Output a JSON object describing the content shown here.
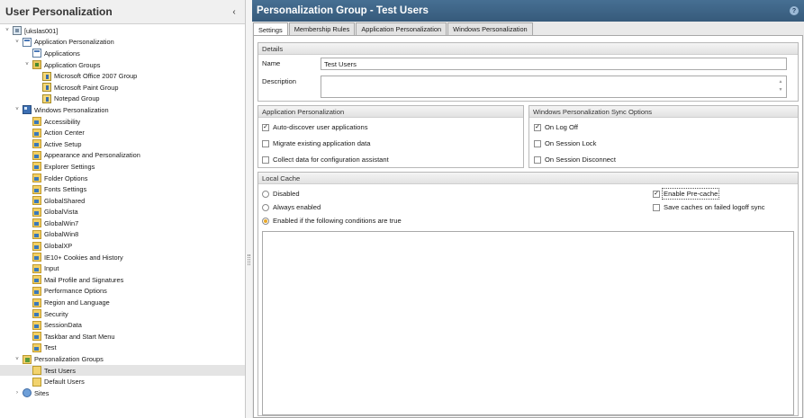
{
  "left_panel": {
    "title": "User Personalization",
    "collapse_glyph": "‹",
    "tree": [
      {
        "label": "[ukslas001]",
        "level": 0,
        "icon": "server-icon",
        "expander": "˅"
      },
      {
        "label": "Application Personalization",
        "level": 1,
        "icon": "app-icon",
        "expander": "˅"
      },
      {
        "label": "Applications",
        "level": 2,
        "icon": "app-icon",
        "expander": ""
      },
      {
        "label": "Application Groups",
        "level": 2,
        "icon": "group-icon",
        "expander": "˅"
      },
      {
        "label": "Microsoft Office 2007 Group",
        "level": 3,
        "icon": "group-item-icon",
        "expander": ""
      },
      {
        "label": "Microsoft Paint Group",
        "level": 3,
        "icon": "group-item-icon",
        "expander": ""
      },
      {
        "label": "Notepad Group",
        "level": 3,
        "icon": "group-item-icon",
        "expander": ""
      },
      {
        "label": "Windows Personalization",
        "level": 1,
        "icon": "windows-icon",
        "expander": "˅"
      },
      {
        "label": "Accessibility",
        "level": 2,
        "icon": "folder-icon",
        "expander": ""
      },
      {
        "label": "Action Center",
        "level": 2,
        "icon": "folder-icon",
        "expander": ""
      },
      {
        "label": "Active Setup",
        "level": 2,
        "icon": "folder-icon",
        "expander": ""
      },
      {
        "label": "Appearance and Personalization",
        "level": 2,
        "icon": "folder-icon",
        "expander": ""
      },
      {
        "label": "Explorer Settings",
        "level": 2,
        "icon": "folder-icon",
        "expander": ""
      },
      {
        "label": "Folder Options",
        "level": 2,
        "icon": "folder-icon",
        "expander": ""
      },
      {
        "label": "Fonts Settings",
        "level": 2,
        "icon": "folder-icon",
        "expander": ""
      },
      {
        "label": "GlobalShared",
        "level": 2,
        "icon": "folder-icon",
        "expander": ""
      },
      {
        "label": "GlobalVista",
        "level": 2,
        "icon": "folder-icon",
        "expander": ""
      },
      {
        "label": "GlobalWin7",
        "level": 2,
        "icon": "folder-icon",
        "expander": ""
      },
      {
        "label": "GlobalWin8",
        "level": 2,
        "icon": "folder-icon",
        "expander": ""
      },
      {
        "label": "GlobalXP",
        "level": 2,
        "icon": "folder-icon",
        "expander": ""
      },
      {
        "label": "IE10+ Cookies and History",
        "level": 2,
        "icon": "folder-icon",
        "expander": ""
      },
      {
        "label": "Input",
        "level": 2,
        "icon": "folder-icon",
        "expander": ""
      },
      {
        "label": "Mail Profile and Signatures",
        "level": 2,
        "icon": "folder-icon",
        "expander": ""
      },
      {
        "label": "Performance Options",
        "level": 2,
        "icon": "folder-icon",
        "expander": ""
      },
      {
        "label": "Region and Language",
        "level": 2,
        "icon": "folder-icon",
        "expander": ""
      },
      {
        "label": "Security",
        "level": 2,
        "icon": "folder-icon",
        "expander": ""
      },
      {
        "label": "SessionData",
        "level": 2,
        "icon": "folder-icon",
        "expander": ""
      },
      {
        "label": "Taskbar and Start Menu",
        "level": 2,
        "icon": "folder-icon",
        "expander": ""
      },
      {
        "label": "Test",
        "level": 2,
        "icon": "folder-icon",
        "expander": ""
      },
      {
        "label": "Personalization Groups",
        "level": 1,
        "icon": "personalization-group-icon",
        "expander": "˅"
      },
      {
        "label": "Test Users",
        "level": 2,
        "icon": "user-group-icon",
        "expander": "",
        "selected": true
      },
      {
        "label": "Default Users",
        "level": 2,
        "icon": "user-group-icon",
        "expander": ""
      },
      {
        "label": "Sites",
        "level": 1,
        "icon": "sites-icon",
        "expander": "›"
      }
    ]
  },
  "right_panel": {
    "title": "Personalization Group - Test Users",
    "help_glyph": "?",
    "tabs": [
      "Settings",
      "Membership Rules",
      "Application Personalization",
      "Windows Personalization"
    ],
    "active_tab": 0,
    "details": {
      "header": "Details",
      "name_label": "Name",
      "name_value": "Test Users",
      "description_label": "Description",
      "description_value": ""
    },
    "app_personalization": {
      "header": "Application Personalization",
      "options": [
        {
          "label": "Auto-discover user applications",
          "checked": true
        },
        {
          "label": "Migrate existing application data",
          "checked": false
        },
        {
          "label": "Collect data for configuration assistant",
          "checked": false
        }
      ]
    },
    "sync_options": {
      "header": "Windows Personalization Sync Options",
      "options": [
        {
          "label": "On Log Off",
          "checked": true
        },
        {
          "label": "On Session Lock",
          "checked": false
        },
        {
          "label": "On Session Disconnect",
          "checked": false
        }
      ]
    },
    "local_cache": {
      "header": "Local Cache",
      "radios": [
        {
          "label": "Disabled",
          "selected": false
        },
        {
          "label": "Always enabled",
          "selected": false
        },
        {
          "label": "Enabled if the following conditions are true",
          "selected": true
        }
      ],
      "checks": [
        {
          "label": "Enable Pre-cache",
          "checked": true
        },
        {
          "label": "Save caches on failed logoff sync",
          "checked": false
        }
      ]
    },
    "check_glyph": "✓",
    "scroll_up": "▲",
    "scroll_down": "▼"
  }
}
